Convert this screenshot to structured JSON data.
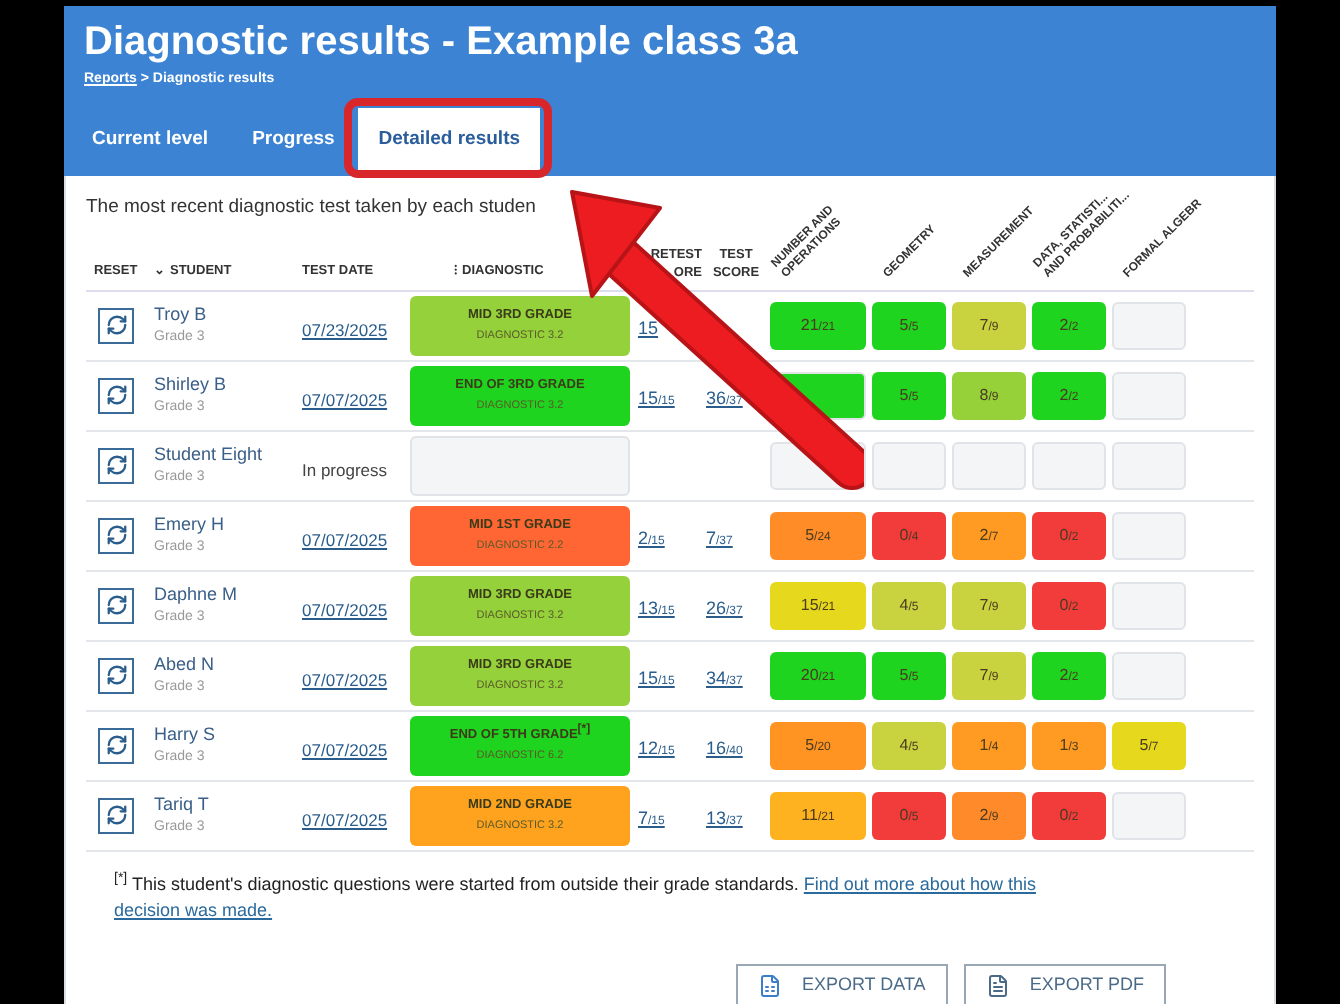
{
  "header": {
    "title": "Diagnostic results - Example class 3a",
    "breadcrumb": {
      "link": "Reports",
      "separator": " > ",
      "current": "Diagnostic results"
    }
  },
  "tabs": [
    {
      "label": "Current level",
      "selected": false
    },
    {
      "label": "Progress",
      "selected": false
    },
    {
      "label": "Detailed results",
      "selected": true
    }
  ],
  "subtitle": "The most recent diagnostic test taken by each studen",
  "table": {
    "columns": {
      "reset": "RESET",
      "student": "STUDENT",
      "student_sort": "⌄",
      "date": "TEST DATE",
      "diagnostic": "DIAGNOSTIC",
      "diagnostic_sort": "⁝",
      "pretest": [
        "RETEST",
        "ORE"
      ],
      "test": "TEST SCORE"
    },
    "strands": [
      {
        "lines": [
          "NUMBER AND",
          "OPERATIONS"
        ]
      },
      {
        "lines": [
          "GEOMETRY"
        ]
      },
      {
        "lines": [
          "MEASUREMENT"
        ]
      },
      {
        "lines": [
          "DATA, STATISTI...",
          "AND PROBABILITI..."
        ]
      },
      {
        "lines": [
          "FORMAL ALGEBR"
        ]
      }
    ],
    "rows": [
      {
        "name": "Troy B",
        "grade": "Grade 3",
        "date": "07/23/2025",
        "diagnostic": {
          "label": "MID 3RD GRADE",
          "sub": "DIAGNOSTIC 3.2",
          "color": "#94d13a"
        },
        "pretest": {
          "score": "15"
        },
        "strands": [
          {
            "score": "21",
            "total": "/21",
            "color": "#1fd41f"
          },
          {
            "score": "5",
            "total": "/5",
            "color": "#1fd41f"
          },
          {
            "score": "7",
            "total": "/9",
            "color": "#c9d33f"
          },
          {
            "score": "2",
            "total": "/2",
            "color": "#1fd41f"
          },
          {
            "color": "#f4f5f7"
          }
        ]
      },
      {
        "name": "Shirley B",
        "grade": "Grade 3",
        "date": "07/07/2025",
        "diagnostic": {
          "label": "END OF 3RD GRADE",
          "sub": "DIAGNOSTIC 3.2",
          "color": "#1fd41f"
        },
        "pretest": {
          "score": "15",
          "total": "/15"
        },
        "test": {
          "score": "36",
          "total": "/37"
        },
        "strands": [
          {
            "color": "#1fd41f"
          },
          {
            "score": "5",
            "total": "/5",
            "color": "#1fd41f"
          },
          {
            "score": "8",
            "total": "/9",
            "color": "#96d13a"
          },
          {
            "score": "2",
            "total": "/2",
            "color": "#1fd41f"
          },
          {
            "color": "#f4f5f7"
          }
        ]
      },
      {
        "name": "Student Eight",
        "grade": "Grade 3",
        "status": "In progress",
        "diagnostic": {
          "color": "#f4f5f7"
        },
        "strands": [
          {
            "color": "#f4f5f7"
          },
          {
            "color": "#f4f5f7"
          },
          {
            "color": "#f4f5f7"
          },
          {
            "color": "#f4f5f7"
          },
          {
            "color": "#f4f5f7"
          }
        ]
      },
      {
        "name": "Emery H",
        "grade": "Grade 3",
        "date": "07/07/2025",
        "diagnostic": {
          "label": "MID 1ST GRADE",
          "sub": "DIAGNOSTIC 2.2",
          "color": "#ff6633"
        },
        "pretest": {
          "score": "2",
          "total": "/15"
        },
        "test": {
          "score": "7",
          "total": "/37"
        },
        "strands": [
          {
            "score": "5",
            "total": "/24",
            "color": "#ff8c26"
          },
          {
            "score": "0",
            "total": "/4",
            "color": "#f23c3c"
          },
          {
            "score": "2",
            "total": "/7",
            "color": "#ff9a22"
          },
          {
            "score": "0",
            "total": "/2",
            "color": "#f23c3c"
          },
          {
            "color": "#f4f5f7"
          }
        ]
      },
      {
        "name": "Daphne M",
        "grade": "Grade 3",
        "date": "07/07/2025",
        "diagnostic": {
          "label": "MID 3RD GRADE",
          "sub": "DIAGNOSTIC 3.2",
          "color": "#94d13a"
        },
        "pretest": {
          "score": "13",
          "total": "/15"
        },
        "test": {
          "score": "26",
          "total": "/37"
        },
        "strands": [
          {
            "score": "15",
            "total": "/21",
            "color": "#e6d81c"
          },
          {
            "score": "4",
            "total": "/5",
            "color": "#c9d33f"
          },
          {
            "score": "7",
            "total": "/9",
            "color": "#c9d33f"
          },
          {
            "score": "0",
            "total": "/2",
            "color": "#f23c3c"
          },
          {
            "color": "#f4f5f7"
          }
        ]
      },
      {
        "name": "Abed N",
        "grade": "Grade 3",
        "date": "07/07/2025",
        "diagnostic": {
          "label": "MID 3RD GRADE",
          "sub": "DIAGNOSTIC 3.2",
          "color": "#94d13a"
        },
        "pretest": {
          "score": "15",
          "total": "/15"
        },
        "test": {
          "score": "34",
          "total": "/37"
        },
        "strands": [
          {
            "score": "20",
            "total": "/21",
            "color": "#1fd41f"
          },
          {
            "score": "5",
            "total": "/5",
            "color": "#1fd41f"
          },
          {
            "score": "7",
            "total": "/9",
            "color": "#c9d33f"
          },
          {
            "score": "2",
            "total": "/2",
            "color": "#1fd41f"
          },
          {
            "color": "#f4f5f7"
          }
        ]
      },
      {
        "name": "Harry S",
        "grade": "Grade 3",
        "date": "07/07/2025",
        "diagnostic": {
          "label": "END OF 5TH GRADE",
          "mark": "[*]",
          "sub": "DIAGNOSTIC 6.2",
          "color": "#1fd41f"
        },
        "pretest": {
          "score": "12",
          "total": "/15"
        },
        "test": {
          "score": "16",
          "total": "/40"
        },
        "strands": [
          {
            "score": "5",
            "total": "/20",
            "color": "#ff9422"
          },
          {
            "score": "4",
            "total": "/5",
            "color": "#c9d33f"
          },
          {
            "score": "1",
            "total": "/4",
            "color": "#ff9a22"
          },
          {
            "score": "1",
            "total": "/3",
            "color": "#ff9a22"
          },
          {
            "score": "5",
            "total": "/7",
            "color": "#e6d81c"
          }
        ]
      },
      {
        "name": "Tariq T",
        "grade": "Grade 3",
        "date": "07/07/2025",
        "diagnostic": {
          "label": "MID 2ND GRADE",
          "sub": "DIAGNOSTIC 3.2",
          "color": "#ffa31f"
        },
        "pretest": {
          "score": "7",
          "total": "/15"
        },
        "test": {
          "score": "13",
          "total": "/37"
        },
        "strands": [
          {
            "score": "11",
            "total": "/21",
            "color": "#ffb21f"
          },
          {
            "score": "0",
            "total": "/5",
            "color": "#f23c3c"
          },
          {
            "score": "2",
            "total": "/9",
            "color": "#ff8a2a"
          },
          {
            "score": "0",
            "total": "/2",
            "color": "#f23c3c"
          },
          {
            "color": "#f4f5f7"
          }
        ]
      }
    ]
  },
  "footnote": {
    "mark": "[*]",
    "text": "This student's diagnostic questions were started from outside their grade standards.",
    "link": [
      "Find out more about how this",
      "decision was made."
    ]
  },
  "buttons": [
    {
      "label": "EXPORT DATA",
      "kind": "data"
    },
    {
      "label": "EXPORT PDF",
      "kind": "pdf"
    }
  ]
}
